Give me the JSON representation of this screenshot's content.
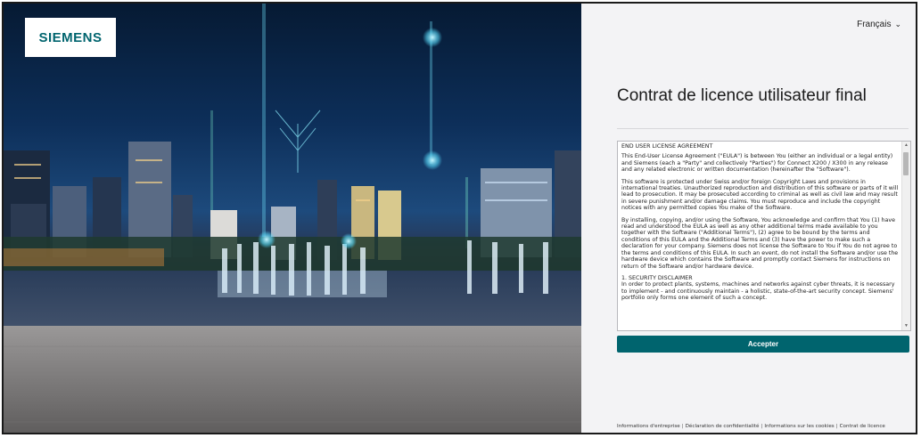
{
  "brand": {
    "logo_text": "SIEMENS",
    "accent_color": "#00646e"
  },
  "language": {
    "selected": "Français",
    "icon": "chevron-down-icon"
  },
  "title": "Contrat de licence utilisateur final",
  "eula": {
    "heading": "END USER LICENSE AGREEMENT",
    "paragraphs": [
      "This End-User License Agreement (\"EULA\") is between You (either an individual or a legal entity) and Siemens (each a \"Party\" and collectively \"Parties\") for Connect X200 / X300 in any release and any related electronic or written documentation (hereinafter the \"Software\").",
      "This software is protected under Swiss and/or foreign Copyright Laws and provisions in international treaties. Unauthorized reproduction and distribution of this software or parts of it will lead to prosecution. It may be prosecuted according to criminal as well as civil law and may result in severe punishment and/or damage claims. You must reproduce and include the copyright notices with any permitted copies You make of the Software.",
      "By installing, copying, and/or using the Software, You acknowledge and confirm that You (1) have read and understood the EULA as well as any other additional terms made available to you together with the Software (\"Additional Terms\"), (2) agree to be bound by the terms and conditions of this EULA and the Additional Terms and (3) have the power to make such a declaration for your company. Siemens does not license the Software to You if You do not agree to the terms and conditions of this EULA. In such an event, do not install the Software and/or use the hardware device which contains the Software and promptly contact Siemens for instructions on return of the Software and/or hardware device.",
      "1. SECURITY DISCLAIMER",
      "In order to protect plants, systems, machines and networks against cyber threats, it is necessary to implement - and continuously maintain - a holistic, state-of-the-art security concept. Siemens' portfolio only forms one element of such a concept."
    ]
  },
  "accept_label": "Accepter",
  "footer": {
    "links": [
      "Informations d'entreprise",
      "Déclaration de confidentialité",
      "Informations sur les cookies",
      "Contrat de licence utilisateur final"
    ],
    "separator": "|"
  }
}
